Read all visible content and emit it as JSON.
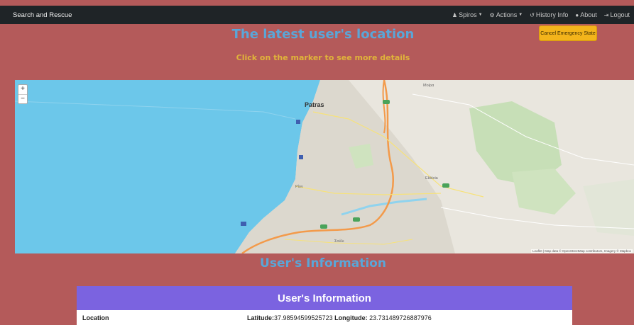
{
  "navbar": {
    "brand": "Search and Rescue",
    "items": [
      {
        "icon": "user-icon",
        "glyph": "♟",
        "label": "Spiros",
        "dropdown": true
      },
      {
        "icon": "gears-icon",
        "glyph": "⚙",
        "label": "Actions",
        "dropdown": true
      },
      {
        "icon": "history-icon",
        "glyph": "↺",
        "label": "History Info",
        "dropdown": false
      },
      {
        "icon": "info-icon",
        "glyph": "●",
        "label": "About",
        "dropdown": false
      },
      {
        "icon": "logout-icon",
        "glyph": "⇥",
        "label": "Logout",
        "dropdown": false
      }
    ]
  },
  "header": {
    "title": "The latest user's location",
    "subtitle": "Click on the marker to see more details",
    "cancel_button": "Cancel Emergency State"
  },
  "map": {
    "zoom_in": "+",
    "zoom_out": "−",
    "attribution": "Leaflet | Map data © OpenStreetMap contributors, Imagery © Mapbox",
    "labels": {
      "patras": "Patras",
      "moira": "Μοίρα",
      "ekkleia": "Ekkleia",
      "rion": "Ρίον",
      "souli": "Σούλι"
    }
  },
  "section": {
    "title": "User's Information"
  },
  "info": {
    "header": "User's Information",
    "location_label": "Location",
    "latitude_label": "Latitude:",
    "latitude_value": "37.98594599525723",
    "longitude_label": "Longitude:",
    "longitude_value": "23.731489726887976"
  },
  "colors": {
    "background": "#b45a5a",
    "navbar": "#1f2427",
    "title": "#5aa6d8",
    "subtitle": "#e0b43a",
    "cancel_button": "#f3b41b",
    "info_header": "#7b63e0",
    "sea": "#6cc7ea"
  }
}
